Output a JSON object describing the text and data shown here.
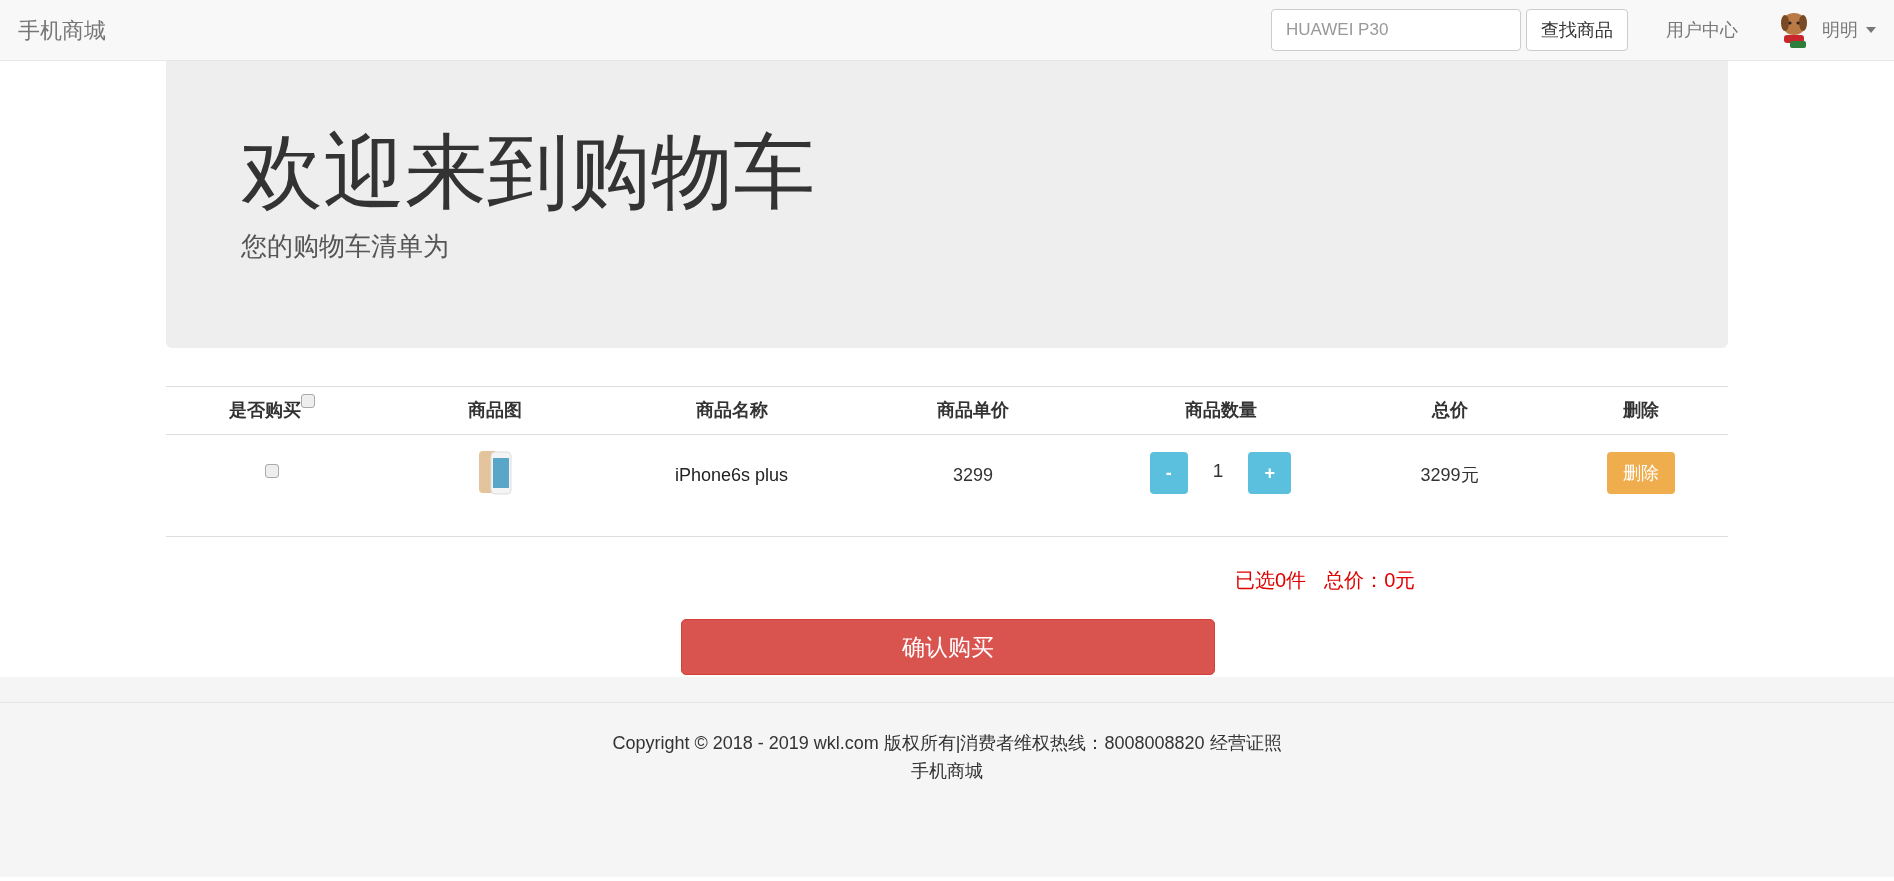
{
  "navbar": {
    "brand": "手机商城",
    "search": {
      "placeholder": "HUAWEI P30"
    },
    "search_button": "查找商品",
    "user_center": "用户中心",
    "user_name": "明明"
  },
  "jumbotron": {
    "title": "欢迎来到购物车",
    "subtitle": "您的购物车清单为"
  },
  "table": {
    "columns": [
      {
        "label": "是否购买",
        "kind": "checkbox",
        "checked": false
      },
      {
        "label": "商品图",
        "kind": "text"
      },
      {
        "label": "商品名称",
        "kind": "text"
      },
      {
        "label": "商品单价",
        "kind": "text"
      },
      {
        "label": "商品数量",
        "kind": "text"
      },
      {
        "label": "总价",
        "kind": "text"
      },
      {
        "label": "删除",
        "kind": "text"
      }
    ],
    "rows": [
      {
        "checked": false,
        "name": "iPhone6s plus",
        "price": "3299",
        "minus": "-",
        "quantity": "1",
        "plus": "+",
        "total": "3299元",
        "delete": "删除"
      }
    ]
  },
  "summary": {
    "selected": "已选0件",
    "total": "总价：0元"
  },
  "confirm_button": "确认购买",
  "footer": {
    "copyright": "Copyright © 2018 - 2019 wkl.com 版权所有|消费者维权热线：8008008820 经营证照",
    "site": "手机商城"
  }
}
